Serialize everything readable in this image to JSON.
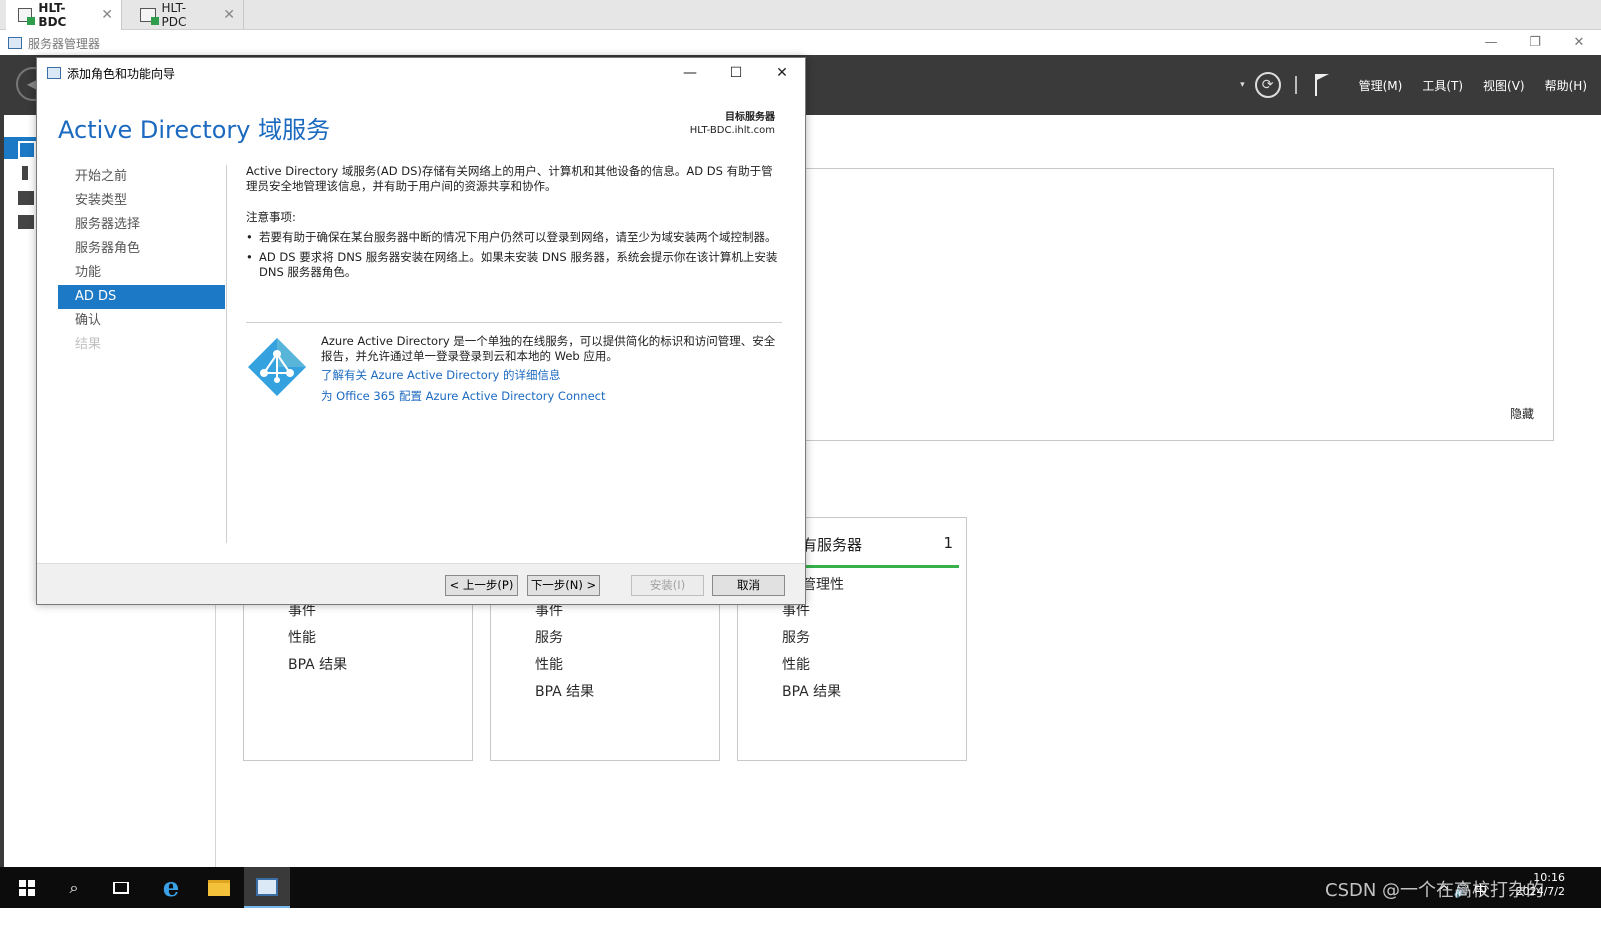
{
  "vm_tabs": [
    {
      "label": "HLT-BDC",
      "close": "✕"
    },
    {
      "label": "HLT-PDC",
      "close": "✕"
    }
  ],
  "server_manager": {
    "title": "服务器管理器",
    "window_controls": {
      "minimize": "—",
      "restore": "❐",
      "close": "✕"
    },
    "toolbar": {
      "back": "◀",
      "caret": "▾",
      "refresh": "⟳",
      "menus": [
        "管理(M)",
        "工具(T)",
        "视图(V)",
        "帮助(H)"
      ]
    },
    "panel_hide": "隐藏",
    "tiles": [
      {
        "items": [
          "事件",
          "性能",
          "BPA 结果"
        ]
      },
      {
        "items": [
          "事件",
          "服务",
          "性能",
          "BPA 结果"
        ]
      },
      {
        "title": "有服务器",
        "count": "1",
        "subtitle": "管理性",
        "items": [
          "事件",
          "服务",
          "性能",
          "BPA 结果"
        ]
      }
    ]
  },
  "wizard": {
    "title": "添加角色和功能向导",
    "controls": {
      "minimize": "—",
      "maximize": "☐",
      "close": "✕"
    },
    "heading": "Active Directory 域服务",
    "target_label": "目标服务器",
    "target_value": "HLT-BDC.ihlt.com",
    "steps": [
      {
        "label": "开始之前",
        "state": "normal"
      },
      {
        "label": "安装类型",
        "state": "normal"
      },
      {
        "label": "服务器选择",
        "state": "normal"
      },
      {
        "label": "服务器角色",
        "state": "normal"
      },
      {
        "label": "功能",
        "state": "normal"
      },
      {
        "label": "AD DS",
        "state": "active"
      },
      {
        "label": "确认",
        "state": "normal"
      },
      {
        "label": "结果",
        "state": "disabled"
      }
    ],
    "intro": "Active Directory 域服务(AD DS)存储有关网络上的用户、计算机和其他设备的信息。AD DS 有助于管理员安全地管理该信息，并有助于用户间的资源共享和协作。",
    "notes_title": "注意事项:",
    "notes": [
      "若要有助于确保在某台服务器中断的情况下用户仍然可以登录到网络，请至少为域安装两个域控制器。",
      "AD DS 要求将 DNS 服务器安装在网络上。如果未安装 DNS 服务器，系统会提示你在该计算机上安装 DNS 服务器角色。"
    ],
    "azure_text": "Azure Active Directory 是一个单独的在线服务，可以提供简化的标识和访问管理、安全报告，并允许通过单一登录登录到云和本地的 Web 应用。",
    "azure_links": [
      "了解有关 Azure Active Directory 的详细信息",
      "为 Office 365 配置 Azure Active Directory Connect"
    ],
    "buttons": {
      "previous": "< 上一步(P)",
      "next": "下一步(N) >",
      "install": "安装(I)",
      "cancel": "取消"
    }
  },
  "taskbar": {
    "search": "⌕",
    "tray_icons": "^ 🔊 中",
    "time": "10:16",
    "date": "2024/7/2"
  },
  "watermark": "CSDN @一个在高校打杂的",
  "colors": {
    "accent": "#1b79c6",
    "link": "#1b6ac0",
    "tile_green": "#35b04b",
    "toolbar_dark": "#3a3a3a"
  }
}
